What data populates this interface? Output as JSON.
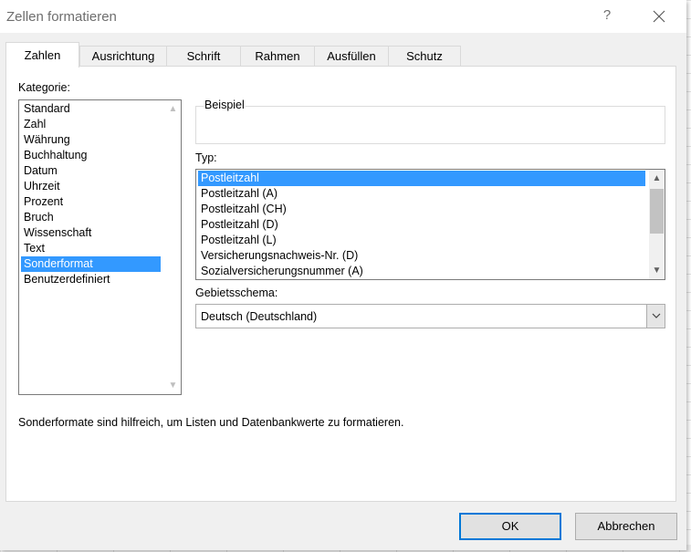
{
  "dialog": {
    "title": "Zellen formatieren",
    "help_label": "?",
    "close_label": "✕"
  },
  "tabs": [
    {
      "label": "Zahlen",
      "active": true
    },
    {
      "label": "Ausrichtung"
    },
    {
      "label": "Schrift"
    },
    {
      "label": "Rahmen"
    },
    {
      "label": "Ausfüllen"
    },
    {
      "label": "Schutz"
    }
  ],
  "category": {
    "label": "Kategorie:",
    "items": [
      "Standard",
      "Zahl",
      "Währung",
      "Buchhaltung",
      "Datum",
      "Uhrzeit",
      "Prozent",
      "Bruch",
      "Wissenschaft",
      "Text",
      "Sonderformat",
      "Benutzerdefiniert"
    ],
    "selected": "Sonderformat"
  },
  "example": {
    "label": "Beispiel",
    "value": ""
  },
  "type": {
    "label": "Typ:",
    "items": [
      "Postleitzahl",
      "Postleitzahl (A)",
      "Postleitzahl (CH)",
      "Postleitzahl (D)",
      "Postleitzahl (L)",
      "Versicherungsnachweis-Nr. (D)",
      "Sozialversicherungsnummer (A)"
    ],
    "selected": "Postleitzahl"
  },
  "locale": {
    "label": "Gebietsschema:",
    "value": "Deutsch (Deutschland)"
  },
  "description": "Sonderformate sind hilfreich, um Listen und Datenbankwerte zu formatieren.",
  "buttons": {
    "ok": "OK",
    "cancel": "Abbrechen"
  },
  "icons": {
    "scroll_up": "▲",
    "scroll_down": "▼",
    "dropdown": "chevron-down-icon"
  },
  "colors": {
    "selection": "#3399ff",
    "default_button_border": "#0078d7"
  }
}
